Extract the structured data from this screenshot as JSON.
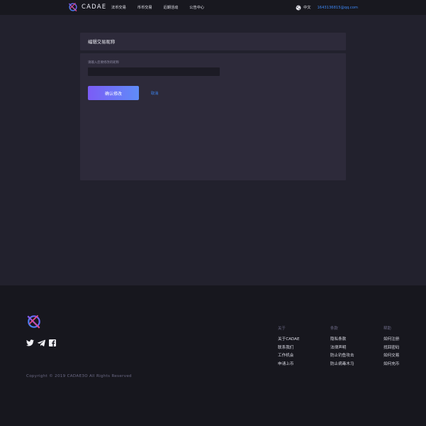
{
  "header": {
    "brand": "CADAE",
    "nav": [
      "法币交易",
      "币币交易",
      "近期活动",
      "公告中心"
    ],
    "language": "中文",
    "user_email": "1643136815@qq.com"
  },
  "edit": {
    "title": "编辑交易昵称",
    "field_label": "请输入您要修改的昵称",
    "input_value": "",
    "confirm_label": "确认修改",
    "cancel_label": "取消"
  },
  "footer": {
    "columns": [
      {
        "title": "关于",
        "links": [
          "关于CADAE",
          "联系我们",
          "工作机会",
          "申请上币"
        ]
      },
      {
        "title": "条款",
        "links": [
          "隐私条款",
          "法律声明",
          "防止钓鱼攻击",
          "防止病毒木马"
        ]
      },
      {
        "title": "帮助",
        "links": [
          "如何注册",
          "找回密码",
          "如何交易",
          "如何充币"
        ]
      }
    ],
    "social_icons": [
      "twitter-icon",
      "telegram-icon",
      "facebook-icon"
    ],
    "copyright": "Copyright © 2019 CADAE3O All Rights Reserved"
  },
  "colors": {
    "accent_blue": "#3d87f5",
    "button_gradient_start": "#7b5cf6",
    "button_gradient_end": "#5f8cf8",
    "panel": "#2d2a3a",
    "page_bg": "#22212d",
    "footer_bg": "#17171e"
  }
}
